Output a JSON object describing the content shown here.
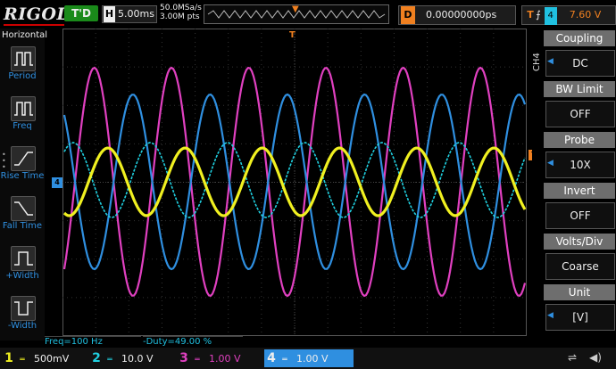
{
  "header": {
    "logo": "RIGOL",
    "trigger_status": "T'D",
    "horizontal_label": "H",
    "timebase": "5.00ms",
    "sample_rate": "50.0MSa/s",
    "memory_depth": "3.00M pts",
    "delay_label": "D",
    "delay_value": "0.00000000ps",
    "trigger_label": "T",
    "trigger_channel": "4",
    "trigger_level": "7.60 V"
  },
  "left_menu": {
    "title": "Horizontal",
    "items": [
      {
        "label": "Period",
        "icon": "period-icon"
      },
      {
        "label": "Freq",
        "icon": "freq-icon"
      },
      {
        "label": "Rise Time",
        "icon": "rise-time-icon"
      },
      {
        "label": "Fall Time",
        "icon": "fall-time-icon"
      },
      {
        "label": "+Width",
        "icon": "plus-width-icon"
      },
      {
        "label": "-Width",
        "icon": "minus-width-icon"
      }
    ]
  },
  "measurements": {
    "freq": "Freq=100 Hz",
    "duty": "-Duty=49.00 %"
  },
  "right_menu": {
    "channel": "CH4",
    "items": [
      {
        "head": "Coupling",
        "value": "DC"
      },
      {
        "head": "BW Limit",
        "value": "OFF"
      },
      {
        "head": "Probe",
        "value": "10X"
      },
      {
        "head": "Invert",
        "value": "OFF"
      },
      {
        "head": "Volts/Div",
        "value": "Coarse"
      },
      {
        "head": "Unit",
        "value": "[V]"
      }
    ]
  },
  "channels": [
    {
      "num": "1",
      "scale": "500mV",
      "color": "#f0f020"
    },
    {
      "num": "2",
      "scale": "10.0 V",
      "color": "#20d0e0"
    },
    {
      "num": "3",
      "scale": "1.00 V",
      "color": "#e040c0"
    },
    {
      "num": "4",
      "scale": "1.00 V",
      "color": "#2f8fe0"
    }
  ],
  "colors": {
    "ch1": "#f0f020",
    "ch2": "#20d0e0",
    "ch3": "#e040c0",
    "ch4": "#2f8fe0",
    "accent": "#f08020"
  }
}
